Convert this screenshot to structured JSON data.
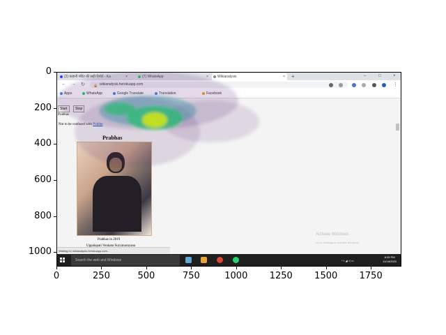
{
  "browser": {
    "tabs": [
      {
        "label": "(2) कहानी मंदिर की सही रिपोर्ट - Ka",
        "fav_color": "#3a3aff"
      },
      {
        "label": "(7) WhatsApp",
        "fav_color": "#25d366"
      },
      {
        "label": "Wikianalysis",
        "fav_color": "#888888"
      }
    ],
    "new_tab": "+",
    "window_controls": [
      "–",
      "□",
      "×"
    ],
    "url": "wikianalysis.herokuapp.com",
    "bookmarks": [
      {
        "label": "Apps",
        "color": "#4285f4"
      },
      {
        "label": "WhatsApp",
        "color": "#25d366"
      },
      {
        "label": "Google Translate",
        "color": "#4285f4"
      },
      {
        "label": "Translation",
        "color": "#4285f4"
      },
      {
        "label": "Facebook",
        "color": "#f7a21b"
      }
    ]
  },
  "page": {
    "start_button": "Start",
    "stop_button": "Stop",
    "search_term": "Prabhas",
    "hatnote_prefix": "Not to be confused with ",
    "hatnote_link": "Prabhu",
    "infobox_title": "Prabhas",
    "photo_caption": "Prabhas in 2019",
    "born_name": "Uppalapati Venkata Suryanarayana",
    "status_text": "Waiting for wikianalysis.herokuapp.com...",
    "watermark_title": "Activate Windows",
    "watermark_sub": "Go to Settings to activate Windows."
  },
  "taskbar": {
    "search_placeholder": "Search the web and Windows",
    "time": "8:35 PM",
    "date": "11/18/2020"
  },
  "axes": {
    "x_ticks": [
      "0",
      "250",
      "500",
      "750",
      "1000",
      "1250",
      "1500",
      "1750"
    ],
    "y_ticks": [
      "0",
      "200",
      "400",
      "600",
      "800",
      "1000"
    ]
  },
  "colors": {
    "heat_outer": "#5b2a7a",
    "heat_mid": "#3b8fa3",
    "heat_inner": "#35b779",
    "heat_peak": "#c8e020"
  }
}
